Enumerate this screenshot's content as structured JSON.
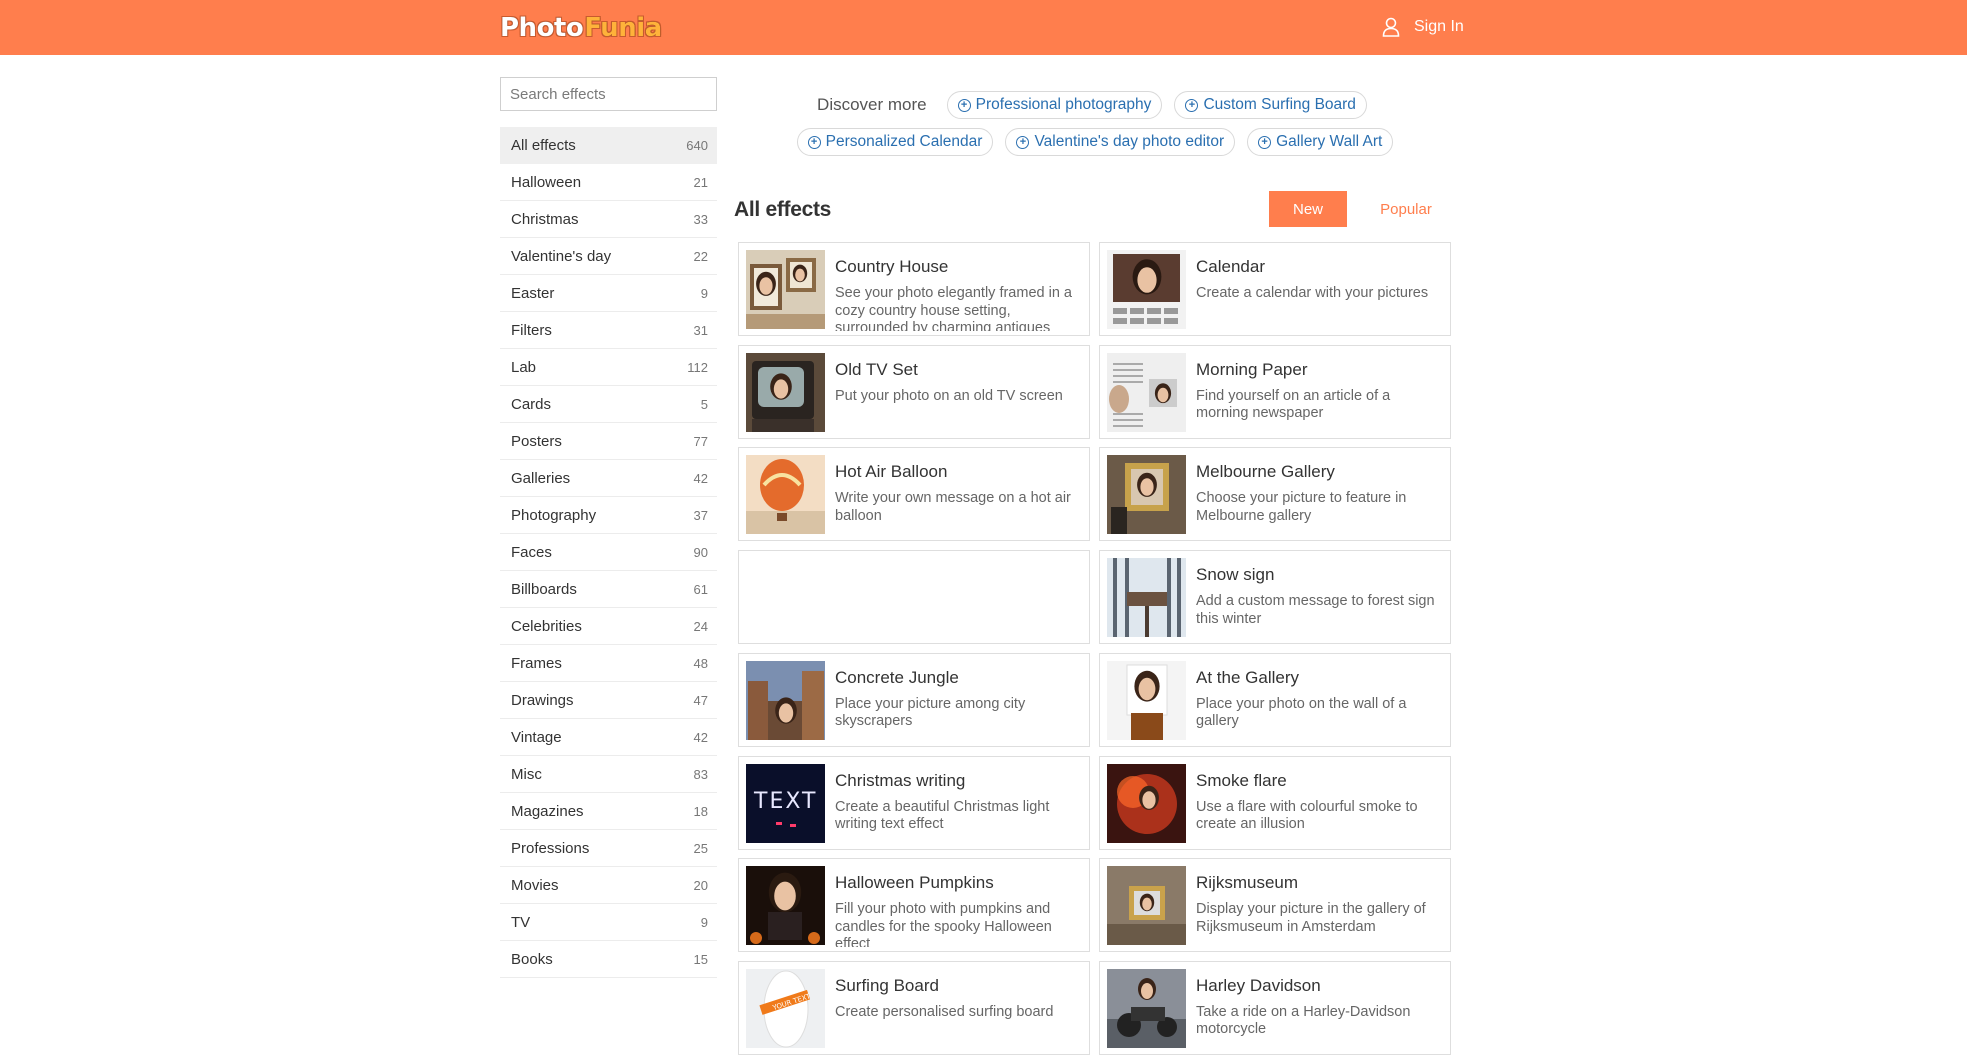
{
  "header": {
    "logo_part1": "Photo",
    "logo_part2": "Funia",
    "signin_label": "Sign In",
    "brand_color": "#ff7e4d"
  },
  "search": {
    "placeholder": "Search effects"
  },
  "categories": [
    {
      "name": "All effects",
      "count": "640"
    },
    {
      "name": "Halloween",
      "count": "21"
    },
    {
      "name": "Christmas",
      "count": "33"
    },
    {
      "name": "Valentine's day",
      "count": "22"
    },
    {
      "name": "Easter",
      "count": "9"
    },
    {
      "name": "Filters",
      "count": "31"
    },
    {
      "name": "Lab",
      "count": "112"
    },
    {
      "name": "Cards",
      "count": "5"
    },
    {
      "name": "Posters",
      "count": "77"
    },
    {
      "name": "Galleries",
      "count": "42"
    },
    {
      "name": "Photography",
      "count": "37"
    },
    {
      "name": "Faces",
      "count": "90"
    },
    {
      "name": "Billboards",
      "count": "61"
    },
    {
      "name": "Celebrities",
      "count": "24"
    },
    {
      "name": "Frames",
      "count": "48"
    },
    {
      "name": "Drawings",
      "count": "47"
    },
    {
      "name": "Vintage",
      "count": "42"
    },
    {
      "name": "Misc",
      "count": "83"
    },
    {
      "name": "Magazines",
      "count": "18"
    },
    {
      "name": "Professions",
      "count": "25"
    },
    {
      "name": "Movies",
      "count": "20"
    },
    {
      "name": "TV",
      "count": "9"
    },
    {
      "name": "Books",
      "count": "15"
    }
  ],
  "discover": {
    "label": "Discover more",
    "links": [
      "Professional photography",
      "Custom Surfing Board",
      "Personalized Calendar",
      "Valentine's day photo editor",
      "Gallery Wall Art"
    ]
  },
  "main": {
    "heading": "All effects",
    "sort_new": "New",
    "sort_popular": "Popular"
  },
  "effects": [
    {
      "title": "Country House",
      "desc": "See your photo elegantly framed in a cozy country house setting, surrounded by charming antiques",
      "icon": "country-house-thumb"
    },
    {
      "title": "Calendar",
      "desc": "Create a calendar with your pictures",
      "icon": "calendar-thumb"
    },
    {
      "title": "Old TV Set",
      "desc": "Put your photo on an old TV screen",
      "icon": "old-tv-thumb"
    },
    {
      "title": "Morning Paper",
      "desc": "Find yourself on an article of a morning newspaper",
      "icon": "newspaper-thumb"
    },
    {
      "title": "Hot Air Balloon",
      "desc": "Write your own message on a hot air balloon",
      "icon": "balloon-thumb"
    },
    {
      "title": "Melbourne Gallery",
      "desc": "Choose your picture to feature in Melbourne gallery",
      "icon": "gallery-frame-thumb"
    },
    {
      "title": "",
      "desc": "",
      "icon": ""
    },
    {
      "title": "Snow sign",
      "desc": "Add a custom message to forest sign this winter",
      "icon": "snow-sign-thumb"
    },
    {
      "title": "Concrete Jungle",
      "desc": "Place your picture among city skyscrapers",
      "icon": "city-thumb"
    },
    {
      "title": "At the Gallery",
      "desc": "Place your photo on the wall of a gallery",
      "icon": "wall-gallery-thumb"
    },
    {
      "title": "Christmas writing",
      "desc": "Create a beautiful Christmas light writing text effect",
      "icon": "light-writing-thumb"
    },
    {
      "title": "Smoke flare",
      "desc": "Use a flare with colourful smoke to create an illusion",
      "icon": "smoke-flare-thumb"
    },
    {
      "title": "Halloween Pumpkins",
      "desc": "Fill your photo with pumpkins and candles for the spooky Halloween effect",
      "icon": "pumpkins-thumb"
    },
    {
      "title": "Rijksmuseum",
      "desc": "Display your picture in the gallery of Rijksmuseum in Amsterdam",
      "icon": "museum-thumb"
    },
    {
      "title": "Surfing Board",
      "desc": "Create personalised surfing board",
      "icon": "surfboard-thumb"
    },
    {
      "title": "Harley Davidson",
      "desc": "Take a ride on a Harley-Davidson motorcycle",
      "icon": "motorcycle-thumb"
    }
  ],
  "thumb_text": {
    "christmas_writing": "TEXT",
    "surfboard": "YOUR TEXT"
  }
}
